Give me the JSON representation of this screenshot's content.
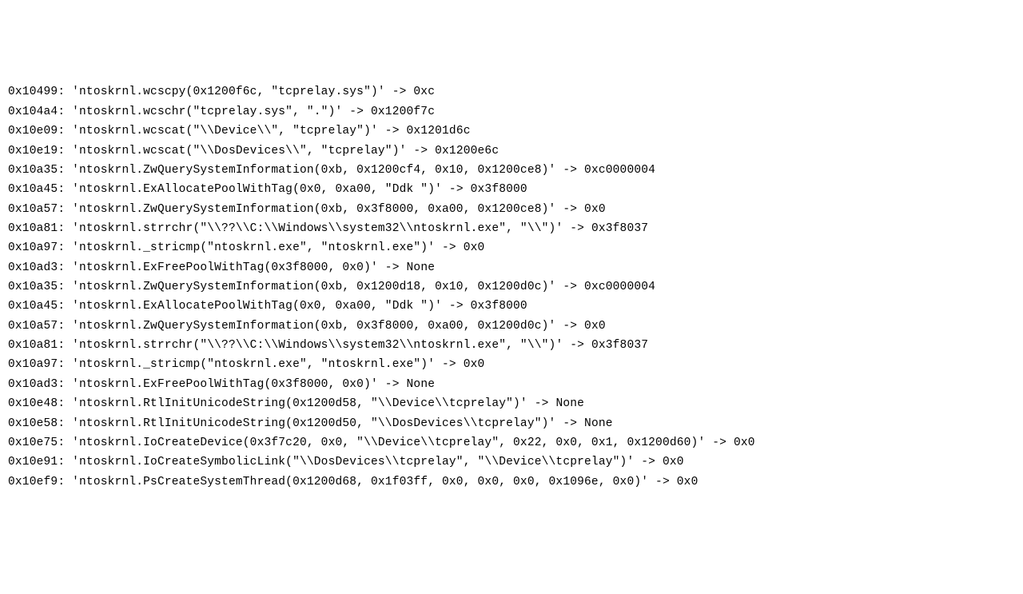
{
  "trace": [
    {
      "addr": "0x10499",
      "call": "ntoskrnl.wcscpy(0x1200f6c, \"tcprelay.sys\")",
      "ret": "0xc"
    },
    {
      "addr": "0x104a4",
      "call": "ntoskrnl.wcschr(\"tcprelay.sys\", \".\")",
      "ret": "0x1200f7c"
    },
    {
      "addr": "0x10e09",
      "call": "ntoskrnl.wcscat(\"\\\\Device\\\\\", \"tcprelay\")",
      "ret": "0x1201d6c"
    },
    {
      "addr": "0x10e19",
      "call": "ntoskrnl.wcscat(\"\\\\DosDevices\\\\\", \"tcprelay\")",
      "ret": "0x1200e6c"
    },
    {
      "addr": "0x10a35",
      "call": "ntoskrnl.ZwQuerySystemInformation(0xb, 0x1200cf4, 0x10, 0x1200ce8)",
      "ret": "0xc0000004"
    },
    {
      "addr": "0x10a45",
      "call": "ntoskrnl.ExAllocatePoolWithTag(0x0, 0xa00, \"Ddk \")",
      "ret": "0x3f8000"
    },
    {
      "addr": "0x10a57",
      "call": "ntoskrnl.ZwQuerySystemInformation(0xb, 0x3f8000, 0xa00, 0x1200ce8)",
      "ret": "0x0"
    },
    {
      "addr": "0x10a81",
      "call": "ntoskrnl.strrchr(\"\\\\??\\\\C:\\\\Windows\\\\system32\\\\ntoskrnl.exe\", \"\\\\\")",
      "ret": "0x3f8037"
    },
    {
      "addr": "0x10a97",
      "call": "ntoskrnl._stricmp(\"ntoskrnl.exe\", \"ntoskrnl.exe\")",
      "ret": "0x0"
    },
    {
      "addr": "0x10ad3",
      "call": "ntoskrnl.ExFreePoolWithTag(0x3f8000, 0x0)",
      "ret": "None"
    },
    {
      "addr": "0x10a35",
      "call": "ntoskrnl.ZwQuerySystemInformation(0xb, 0x1200d18, 0x10, 0x1200d0c)",
      "ret": "0xc0000004"
    },
    {
      "addr": "0x10a45",
      "call": "ntoskrnl.ExAllocatePoolWithTag(0x0, 0xa00, \"Ddk \")",
      "ret": "0x3f8000"
    },
    {
      "addr": "0x10a57",
      "call": "ntoskrnl.ZwQuerySystemInformation(0xb, 0x3f8000, 0xa00, 0x1200d0c)",
      "ret": "0x0"
    },
    {
      "addr": "0x10a81",
      "call": "ntoskrnl.strrchr(\"\\\\??\\\\C:\\\\Windows\\\\system32\\\\ntoskrnl.exe\", \"\\\\\")",
      "ret": "0x3f8037"
    },
    {
      "addr": "0x10a97",
      "call": "ntoskrnl._stricmp(\"ntoskrnl.exe\", \"ntoskrnl.exe\")",
      "ret": "0x0"
    },
    {
      "addr": "0x10ad3",
      "call": "ntoskrnl.ExFreePoolWithTag(0x3f8000, 0x0)",
      "ret": "None"
    },
    {
      "addr": "0x10e48",
      "call": "ntoskrnl.RtlInitUnicodeString(0x1200d58, \"\\\\Device\\\\tcprelay\")",
      "ret": "None"
    },
    {
      "addr": "0x10e58",
      "call": "ntoskrnl.RtlInitUnicodeString(0x1200d50, \"\\\\DosDevices\\\\tcprelay\")",
      "ret": "None"
    },
    {
      "addr": "0x10e75",
      "call": "ntoskrnl.IoCreateDevice(0x3f7c20, 0x0, \"\\\\Device\\\\tcprelay\", 0x22, 0x0, 0x1, 0x1200d60)",
      "ret": "0x0"
    },
    {
      "addr": "0x10e91",
      "call": "ntoskrnl.IoCreateSymbolicLink(\"\\\\DosDevices\\\\tcprelay\", \"\\\\Device\\\\tcprelay\")",
      "ret": "0x0"
    },
    {
      "addr": "0x10ef9",
      "call": "ntoskrnl.PsCreateSystemThread(0x1200d68, 0x1f03ff, 0x0, 0x0, 0x0, 0x1096e, 0x0)",
      "ret": "0x0"
    }
  ]
}
